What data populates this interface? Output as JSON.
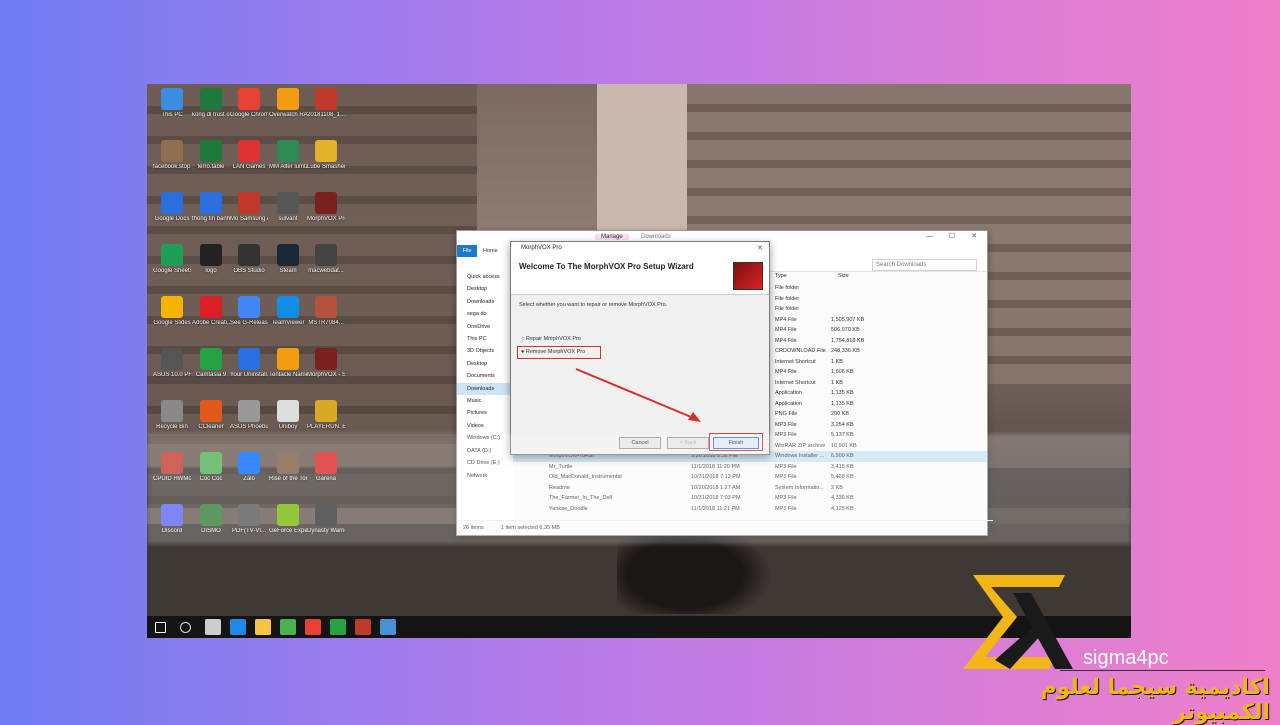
{
  "desktop": {
    "icons": [
      {
        "label": "This PC",
        "color": "#3b8de0"
      },
      {
        "label": "kong dl trust com phim...",
        "color": "#1e7a3c"
      },
      {
        "label": "Google Chrome",
        "color": "#e94235"
      },
      {
        "label": "Overwatch RAR Pa...",
        "color": "#f39c12"
      },
      {
        "label": "20181108_1...",
        "color": "#c0392b"
      },
      {
        "label": "facebook.stop (3).lnk",
        "color": "#8e6e4e"
      },
      {
        "label": "ferro.table",
        "color": "#1e7a3c"
      },
      {
        "label": "LAN Games",
        "color": "#d33"
      },
      {
        "label": "MM Alter lumtar",
        "color": "#2e8b57"
      },
      {
        "label": "Lube Smasher",
        "color": "#e2b22a"
      },
      {
        "label": "Google Docs",
        "color": "#2a6ee0"
      },
      {
        "label": "thong tin banh",
        "color": "#2a6ee0"
      },
      {
        "label": "Mo Samsung APP",
        "color": "#c0392b"
      },
      {
        "label": "sulvant",
        "color": "#555"
      },
      {
        "label": "MorphVOX Pro Sinlet",
        "color": "#7a2020"
      },
      {
        "label": "Google Sheets",
        "color": "#1e9e57"
      },
      {
        "label": "logo",
        "color": "#222"
      },
      {
        "label": "OBS Studio",
        "color": "#333"
      },
      {
        "label": "Steam",
        "color": "#1b2838"
      },
      {
        "label": "macwebdat...",
        "color": "#444"
      },
      {
        "label": "Google Slides",
        "color": "#f4b400"
      },
      {
        "label": "Adobe Creati...",
        "color": "#da1f26"
      },
      {
        "label": "See G-Release...",
        "color": "#4285f4"
      },
      {
        "label": "TeamViewer",
        "color": "#0e8ee9"
      },
      {
        "label": "MSTR7084...",
        "color": "#b5523b"
      },
      {
        "label": "ASUS 10.0 PHOREDS",
        "color": "#555"
      },
      {
        "label": "Camtasia 9",
        "color": "#25a244"
      },
      {
        "label": "Your Uninstall...",
        "color": "#2a6ee0"
      },
      {
        "label": "Tentacle Name...",
        "color": "#f39c12"
      },
      {
        "label": "MorphVOX - Shortcut",
        "color": "#7a2020"
      },
      {
        "label": "Recycle Bin",
        "color": "#888"
      },
      {
        "label": "CCleaner",
        "color": "#e05a1a"
      },
      {
        "label": "ASUS Phoebus",
        "color": "#999"
      },
      {
        "label": "Uniboy",
        "color": "#ddd"
      },
      {
        "label": "PLAYERUN. BATTLEGR...",
        "color": "#d9a825"
      },
      {
        "label": "CPUID HWMonito...",
        "color": "#c0392b"
      },
      {
        "label": "Cốc Cốc",
        "color": "#4caf50"
      },
      {
        "label": "Zalo",
        "color": "#0068ff"
      },
      {
        "label": "Rise of the Tomb Raider",
        "color": "#7a5a40"
      },
      {
        "label": "Garena",
        "color": "#d22"
      },
      {
        "label": "Discord",
        "color": "#5865f2"
      },
      {
        "label": "DISMO",
        "color": "#2e7d32"
      },
      {
        "label": "PDF(TV-VI...",
        "color": "#555"
      },
      {
        "label": "GeForce Experience",
        "color": "#76b900"
      },
      {
        "label": "Dynasty Warriors 9",
        "color": "#333"
      },
      {
        "label": "New Text Document",
        "color": "#eee"
      }
    ]
  },
  "taskbar": {
    "items": [
      "start-icon",
      "cortana-icon",
      "taskview-icon",
      "edge-icon",
      "explorer-icon",
      "store-icon",
      "chrome-icon",
      "camtasia-icon",
      "morphvox-icon",
      "app-icon"
    ],
    "colors": [
      "#fff",
      "#ddd",
      "#ccc",
      "#1e88e5",
      "#f4c542",
      "#4caf50",
      "#e94235",
      "#25a244",
      "#c0392b",
      "#4a90d9"
    ]
  },
  "explorer": {
    "tabs": {
      "manage": "Manage",
      "downloads": "Downloads"
    },
    "ribbon": {
      "file": "File",
      "home": "Home"
    },
    "search_placeholder": "Search Downloads",
    "header": {
      "type": "Type",
      "size": "Size"
    },
    "nav": [
      "Quick access",
      "Desktop",
      "Downloads",
      "sega do",
      "OneDrive",
      "This PC",
      "3D Objects",
      "Desktop",
      "Documents",
      "Downloads",
      "Music",
      "Pictures",
      "Videos",
      "Windows (C:)",
      "DATA (D:)",
      "CD Drive (E:)",
      "Network"
    ],
    "rows": [
      {
        "name": "",
        "type": "File folder",
        "size": ""
      },
      {
        "name": "",
        "type": "File folder",
        "size": ""
      },
      {
        "name": "",
        "type": "File folder",
        "size": ""
      },
      {
        "name": "",
        "type": "MP4 File",
        "size": "1,505,907 KB"
      },
      {
        "name": "",
        "type": "MP4 File",
        "size": "506,070 KB"
      },
      {
        "name": "",
        "type": "MP4 File",
        "size": "1,754,818 KB"
      },
      {
        "name": "",
        "type": "CRDOWNLOAD File",
        "size": "248,336 KB"
      },
      {
        "name": "",
        "type": "Internet Shortcut",
        "size": "1 KB"
      },
      {
        "name": "",
        "type": "MP4 File",
        "size": "1,606 KB"
      },
      {
        "name": "",
        "type": "Internet Shortcut",
        "size": "1 KB"
      },
      {
        "name": "",
        "type": "Application",
        "size": "1,135 KB"
      },
      {
        "name": "",
        "type": "Application",
        "size": "1,135 KB"
      },
      {
        "name": "",
        "type": "PNG File",
        "size": "200 KB"
      },
      {
        "name": "",
        "type": "MP3 File",
        "size": "3,254 KB"
      },
      {
        "name": "",
        "type": "MP3 File",
        "size": "5,137 KB"
      },
      {
        "name": "",
        "type": "WinRAR ZIP archive",
        "size": "10,901 KB"
      },
      {
        "name": "MorphVOXProFull",
        "date": "5.26.2018 9:32 PM",
        "type": "Windows Installer ...",
        "size": "6,500 KB"
      },
      {
        "name": "Mr_Turtle",
        "date": "11/1/2018 11:20 PM",
        "type": "MP3 File",
        "size": "3,415 KB"
      },
      {
        "name": "Old_MacDonald_Instrumental",
        "date": "10/31/2018 7:13 PM",
        "type": "MP3 File",
        "size": "5,468 KB"
      },
      {
        "name": "Readme",
        "date": "10/20/2018 1:27 AM",
        "type": "System Informatio...",
        "size": "2 KB"
      },
      {
        "name": "The_Farmer_In_The_Dell",
        "date": "10/31/2018 7:03 PM",
        "type": "MP3 File",
        "size": "4,336 KB"
      },
      {
        "name": "Yankee_Doodle",
        "date": "11/1/2018 11:21 PM",
        "type": "MP3 File",
        "size": "4,125 KB"
      }
    ],
    "status": {
      "items": "26 items",
      "selected": "1 item selected 6.35 MB"
    }
  },
  "wizard": {
    "title": "MorphVOX Pro",
    "heading": "Welcome To The MorphVOX Pro Setup Wizard",
    "question": "Select whether you want to repair or remove MorphVOX Pro.",
    "repair": "Repair MorphVOX Pro",
    "remove": "Remove MorphVOX Pro",
    "cancel": "Cancel",
    "back": "< Back",
    "finish": "Finish"
  },
  "brand": {
    "name": "sigma4pc",
    "arabic": "اكاديمية سيجما لعلوم الكمبيوتر",
    "accent": "#f2b618"
  }
}
